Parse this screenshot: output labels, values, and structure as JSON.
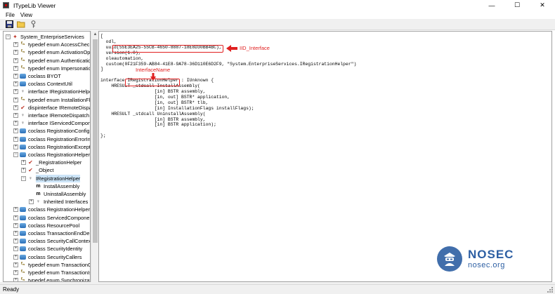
{
  "window": {
    "title": "ITypeLib Viewer",
    "minimize": "—",
    "maximize": "☐",
    "close": "✕"
  },
  "menu": [
    {
      "label": "File"
    },
    {
      "label": "View"
    }
  ],
  "toolbar": {
    "buttons": [
      {
        "icon": "save-icon"
      },
      {
        "icon": "open-folder-icon"
      },
      {
        "icon": "key-icon"
      }
    ]
  },
  "tree": {
    "items": [
      {
        "label": "System_EnterpriseServices",
        "icon": "root-typelib-icon",
        "indent": 0,
        "expander": "−"
      },
      {
        "label": "typedef enum AccessChecks",
        "icon": "typedef-icon",
        "indent": 1,
        "expander": "+"
      },
      {
        "label": "typedef enum ActivationOpt",
        "icon": "typedef-icon",
        "indent": 1,
        "expander": "+"
      },
      {
        "label": "typedef enum Authenticatio",
        "icon": "typedef-icon",
        "indent": 1,
        "expander": "+"
      },
      {
        "label": "typedef enum Impersonatio",
        "icon": "typedef-icon",
        "indent": 1,
        "expander": "+"
      },
      {
        "label": "coclass BYOT",
        "icon": "coclass-icon",
        "indent": 1,
        "expander": "+"
      },
      {
        "label": "coclass ContextUtil",
        "icon": "coclass-icon",
        "indent": 1,
        "expander": "+"
      },
      {
        "label": "interface IRegistrationHelpe",
        "icon": "interface-icon",
        "indent": 1,
        "expander": "+"
      },
      {
        "label": "typedef enum InstallationFla",
        "icon": "typedef-icon",
        "indent": 1,
        "expander": "+"
      },
      {
        "label": "dispinterface IRemoteDispa",
        "icon": "dispinterface-icon",
        "indent": 1,
        "expander": "+"
      },
      {
        "label": "interface IRemoteDispatch",
        "icon": "interface-icon",
        "indent": 1,
        "expander": "+"
      },
      {
        "label": "interface IServicedCompone",
        "icon": "interface-icon",
        "indent": 1,
        "expander": "+"
      },
      {
        "label": "coclass RegistrationConfig",
        "icon": "coclass-icon",
        "indent": 1,
        "expander": "+"
      },
      {
        "label": "coclass RegistrationErrorInf",
        "icon": "coclass-icon",
        "indent": 1,
        "expander": "+"
      },
      {
        "label": "coclass RegistrationExceptic",
        "icon": "coclass-icon",
        "indent": 1,
        "expander": "+"
      },
      {
        "label": "coclass RegistrationHelper",
        "icon": "coclass-icon",
        "indent": 1,
        "expander": "−"
      },
      {
        "label": "_RegistrationHelper",
        "icon": "dispinterface-icon",
        "indent": 2,
        "expander": "+"
      },
      {
        "label": "_Object",
        "icon": "dispinterface-icon",
        "indent": 2,
        "expander": "+"
      },
      {
        "label": "IRegistrationHelper",
        "icon": "interface-icon",
        "indent": 2,
        "expander": "−",
        "selected": true
      },
      {
        "label": "InstallAssembly",
        "icon": "method-icon",
        "indent": 3,
        "expander": ""
      },
      {
        "label": "UninstallAssembly",
        "icon": "method-icon",
        "indent": 3,
        "expander": ""
      },
      {
        "label": "Inherited Interfaces",
        "icon": "interface-icon",
        "indent": 3,
        "expander": "+"
      },
      {
        "label": "coclass RegistrationHelperT",
        "icon": "coclass-icon",
        "indent": 1,
        "expander": "+"
      },
      {
        "label": "coclass ServicedComponent",
        "icon": "coclass-icon",
        "indent": 1,
        "expander": "+"
      },
      {
        "label": "coclass ResourcePool",
        "icon": "coclass-icon",
        "indent": 1,
        "expander": "+"
      },
      {
        "label": "coclass TransactionEndDele",
        "icon": "coclass-icon",
        "indent": 1,
        "expander": "+"
      },
      {
        "label": "coclass SecurityCallContext",
        "icon": "coclass-icon",
        "indent": 1,
        "expander": "+"
      },
      {
        "label": "coclass SecurityIdentity",
        "icon": "coclass-icon",
        "indent": 1,
        "expander": "+"
      },
      {
        "label": "coclass SecurityCallers",
        "icon": "coclass-icon",
        "indent": 1,
        "expander": "+"
      },
      {
        "label": "typedef enum TransactionO",
        "icon": "typedef-icon",
        "indent": 1,
        "expander": "+"
      },
      {
        "label": "typedef enum TransactionIs",
        "icon": "typedef-icon",
        "indent": 1,
        "expander": "+"
      },
      {
        "label": "typedef enum Synchronizati",
        "icon": "typedef-icon",
        "indent": 1,
        "expander": "+"
      }
    ]
  },
  "code": {
    "lines": [
      "[",
      "  odl,",
      "  uuid(55E3EA25-55CB-4650-8887-18E8D30BB4BC),",
      "  version(1.0),",
      "  oleautomation,",
      "  custom(0F21F359-AB84-41E8-9A78-36D110E6D2F9, \"System.EnterpriseServices.IRegistrationHelper\")",
      "]",
      "interface IRegistrationHelper : IUnknown {",
      "    HRESULT _stdcall InstallAssembly(",
      "                    [in] BSTR assembly,",
      "                    [in, out] BSTR* application,",
      "                    [in, out] BSTR* tlb,",
      "                    [in] InstallationFlags installFlags);",
      "    HRESULT _stdcall UninstallAssembly(",
      "                    [in] BSTR assembly,",
      "                    [in] BSTR application);",
      "};"
    ]
  },
  "annotations": {
    "iid_label": "IID_Interface",
    "interface_label": "InterfaceName",
    "color": "#e02020"
  },
  "watermark": {
    "brand": "NOSEC",
    "domain": "nosec.org"
  },
  "status": {
    "text": "Ready"
  }
}
